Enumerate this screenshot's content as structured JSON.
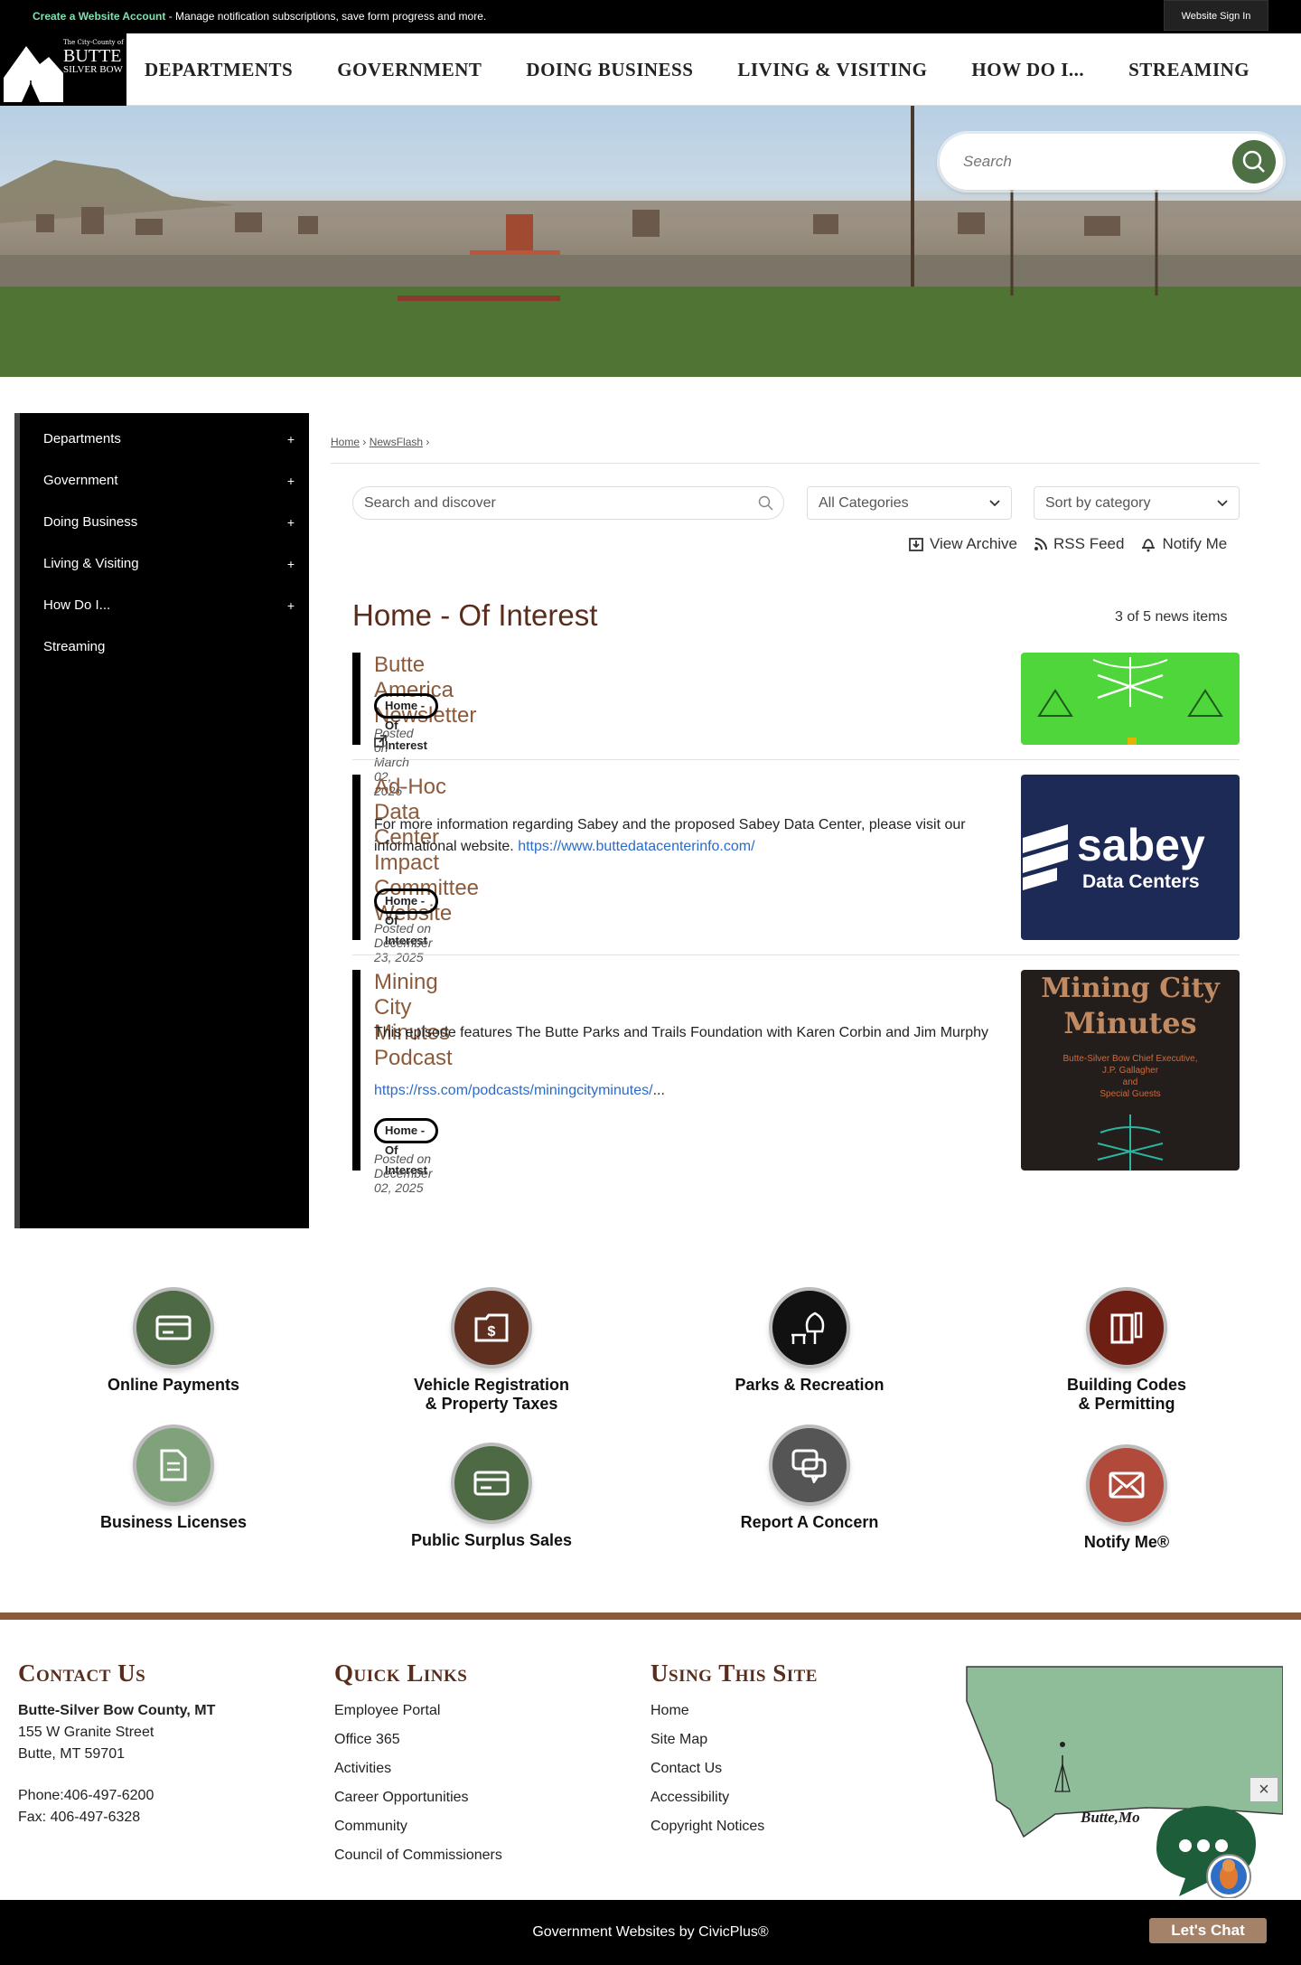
{
  "topbar": {
    "create_link": "Create a Website Account",
    "create_desc": " - Manage notification subscriptions, save form progress and more.",
    "signin": "Website Sign In"
  },
  "logo": {
    "line1": "The City-County of",
    "line2": "BUTTE",
    "line3": "SILVER BOW"
  },
  "nav": [
    "DEPARTMENTS",
    "GOVERNMENT",
    "DOING BUSINESS",
    "LIVING & VISITING",
    "HOW DO I...",
    "STREAMING"
  ],
  "search": {
    "placeholder": "Search"
  },
  "sidebar": [
    {
      "label": "Departments",
      "plus": "+"
    },
    {
      "label": "Government",
      "plus": "+"
    },
    {
      "label": "Doing Business",
      "plus": "+"
    },
    {
      "label": "Living & Visiting",
      "plus": "+"
    },
    {
      "label": "How Do I...",
      "plus": "+"
    },
    {
      "label": "Streaming",
      "plus": ""
    }
  ],
  "breadcrumb": {
    "home": "Home",
    "sep": "›",
    "newsflash": "NewsFlash"
  },
  "filters": {
    "search_placeholder": "Search and discover",
    "category": "All Categories",
    "sort": "Sort by category"
  },
  "actions": {
    "archive": "View Archive",
    "rss": "RSS Feed",
    "notify": "Notify Me"
  },
  "section": {
    "title": "Home - Of Interest",
    "count": "3 of 5 news items"
  },
  "news": [
    {
      "title": "Butte America Newsletter",
      "body": "",
      "link": "",
      "tag": "Home - Of Interest",
      "date": "Posted on March 02, 2026"
    },
    {
      "title": "Ad-Hoc Data Center Impact Committee Website",
      "body": "For more information regarding Sabey and the proposed Sabey Data Center, please visit our informational website. ",
      "link": "https://www.buttedatacenterinfo.com/",
      "tag": "Home - Of Interest",
      "date": "Posted on December 23, 2025"
    },
    {
      "title": "Mining City Minutes Podcast",
      "body": "This episode features The Butte Parks and Trails Foundation with Karen Corbin and Jim Murphy",
      "link": "https://rss.com/podcasts/miningcityminutes/",
      "tag": "Home - Of Interest",
      "date": "Posted on December 02, 2025"
    }
  ],
  "thumbs": {
    "sabey_1": "sabey",
    "sabey_2": "Data Centers",
    "mcm_1": "Mining City",
    "mcm_2": "Minutes",
    "mcm_3": "Butte-Silver Bow Chief Executive,",
    "mcm_4": "J.P. Gallagher",
    "mcm_5": "and",
    "mcm_6": "Special Guests"
  },
  "quicklinks": [
    {
      "label1": "Online Payments",
      "label2": "",
      "color": "#4d6a45"
    },
    {
      "label1": "Vehicle Registration",
      "label2": "& Property Taxes",
      "color": "#5e2e1e"
    },
    {
      "label1": "Parks & Recreation",
      "label2": "",
      "color": "#111111"
    },
    {
      "label1": "Building Codes",
      "label2": "& Permitting",
      "color": "#6e1f14"
    },
    {
      "label1": "Business Licenses",
      "label2": "",
      "color": "#7fa27a"
    },
    {
      "label1": "Public Surplus Sales",
      "label2": "",
      "color": "#4d6a45"
    },
    {
      "label1": "Report A Concern",
      "label2": "",
      "color": "#555555"
    },
    {
      "label1": "Notify Me®",
      "label2": "",
      "color": "#b24a3c"
    }
  ],
  "footer": {
    "contact": {
      "heading": "Contact Us",
      "name": "Butte-Silver Bow County, MT",
      "addr1": "155 W Granite Street",
      "addr2": "Butte, MT 59701",
      "phone": "Phone:406-497-6200",
      "fax": "Fax: 406-497-6328"
    },
    "quick": {
      "heading": "Quick Links",
      "items": [
        "Employee Portal",
        "Office 365",
        "Activities",
        "Career Opportunities",
        "Community",
        "Council of Commissioners"
      ]
    },
    "site": {
      "heading": "Using This Site",
      "items": [
        "Home",
        "Site Map",
        "Contact Us",
        "Accessibility",
        "Copyright Notices"
      ]
    },
    "map_label": "Butte,Mo",
    "credit": "Government Websites by CivicPlus®",
    "chat": "Let's Chat",
    "close": "×"
  }
}
